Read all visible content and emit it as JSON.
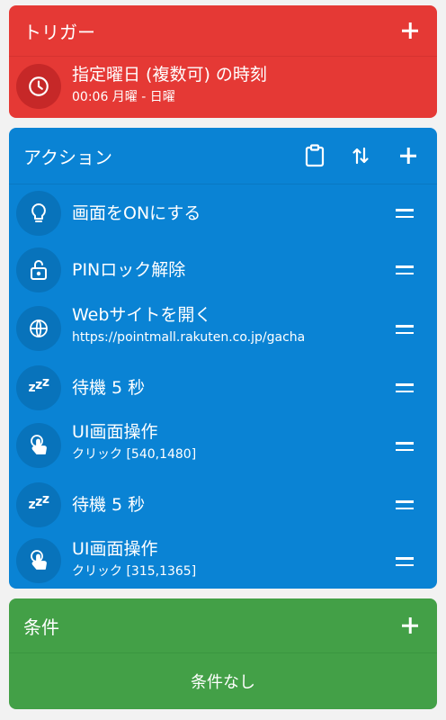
{
  "trigger": {
    "header": "トリガー",
    "item": {
      "icon": "clock-icon",
      "title": "指定曜日 (複数可) の時刻",
      "subtitle": "00:06 月曜 - 日曜"
    }
  },
  "actions": {
    "header": "アクション",
    "header_icons": [
      "clipboard-icon",
      "sort-icon",
      "add-icon"
    ],
    "items": [
      {
        "icon": "lightbulb-icon",
        "title": "画面をONにする"
      },
      {
        "icon": "unlock-icon",
        "title": "PINロック解除"
      },
      {
        "icon": "globe-icon",
        "title": "Webサイトを開く",
        "subtitle": "https://pointmall.rakuten.co.jp/gacha"
      },
      {
        "icon": "sleep-icon",
        "title": "待機 5 秒"
      },
      {
        "icon": "touch-icon",
        "title": "UI画面操作",
        "subtitle": "クリック [540,1480]"
      },
      {
        "icon": "sleep-icon",
        "title": "待機 5 秒"
      },
      {
        "icon": "touch-icon",
        "title": "UI画面操作",
        "subtitle": "クリック [315,1365]"
      }
    ]
  },
  "conditions": {
    "header": "条件",
    "empty_text": "条件なし"
  },
  "colors": {
    "trigger": "#e53935",
    "actions": "#0a83d4",
    "conditions": "#43a047",
    "background": "#f2f2f2"
  }
}
